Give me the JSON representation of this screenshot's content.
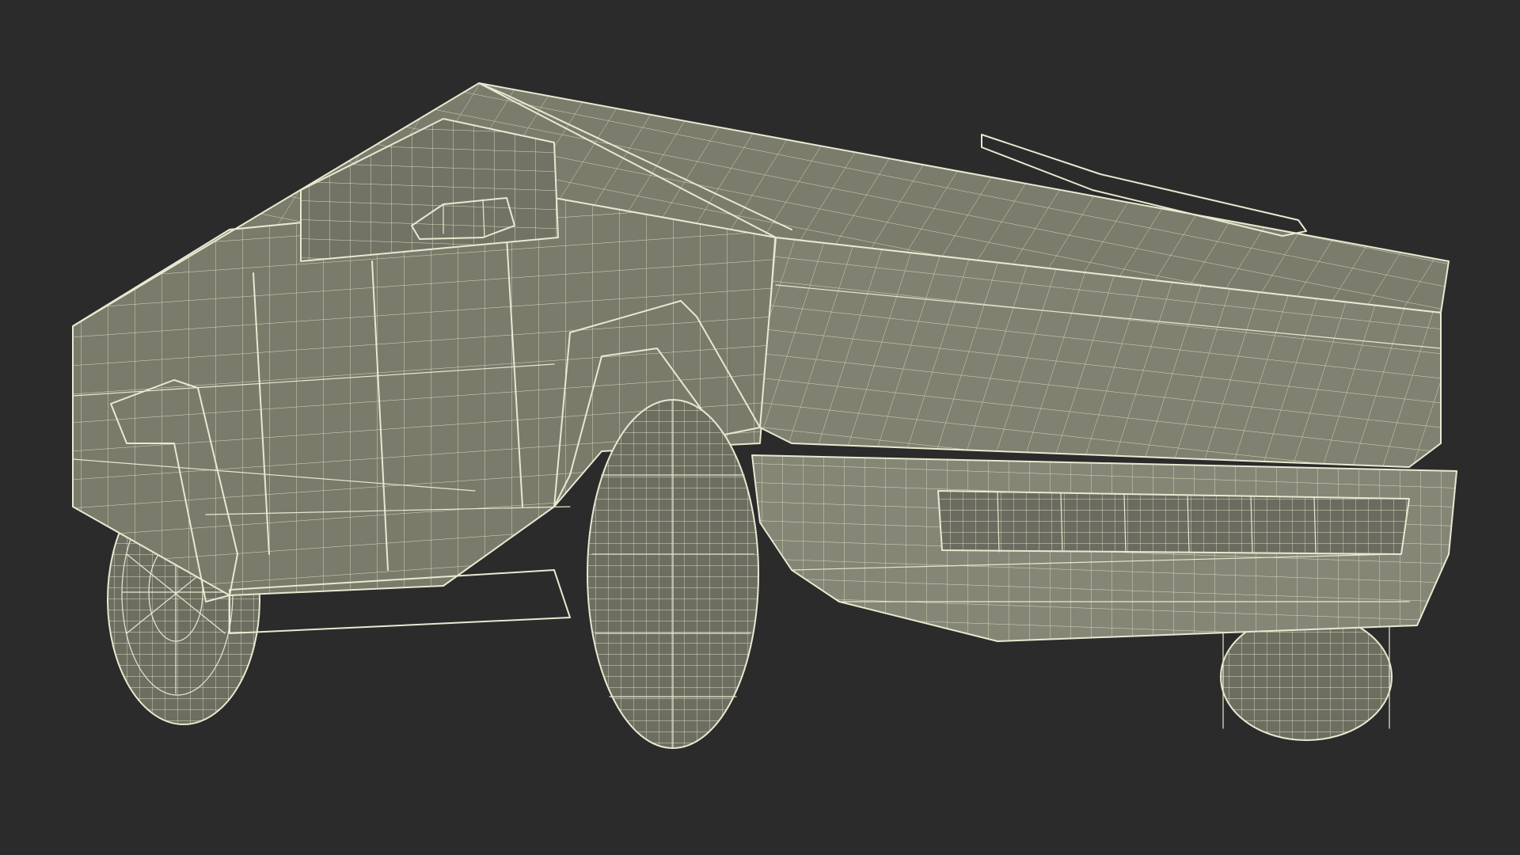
{
  "scene": {
    "subject": "wireframe-pickup-truck",
    "colors": {
      "background": "#2b2b2b",
      "surface": "#7a7b6b",
      "surface_light": "#8a8b7a",
      "surface_dark": "#5f6053",
      "wire": "#e9e8d0",
      "tire": "#6d6e60"
    }
  }
}
